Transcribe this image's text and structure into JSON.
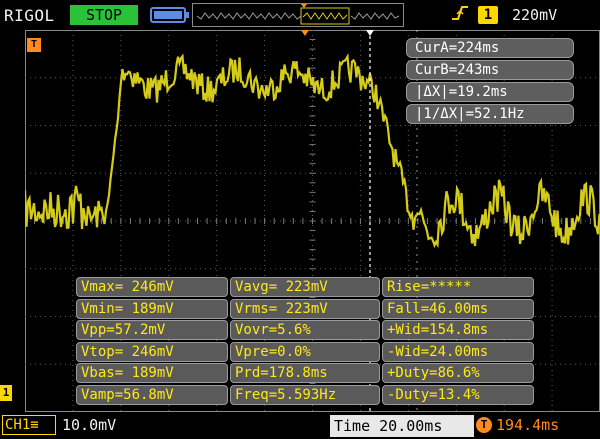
{
  "top_bar": {
    "brand": "RIGOL",
    "run_state": "STOP",
    "trigger_source": "1",
    "trigger_level": "220mV",
    "trigger_edge_icon": "rising-edge-icon"
  },
  "markers": {
    "channel_level": "T",
    "ch1_ground": "1"
  },
  "cursors": {
    "cur_a": "CurA=224ms",
    "cur_b": "CurB=243ms",
    "delta_x": "|ΔX|=19.2ms",
    "inv_delta_x": "|1/ΔX|=52.1Hz"
  },
  "measurements": [
    [
      "Vmax= 246mV",
      "Vavg= 223mV",
      "Rise=*****"
    ],
    [
      "Vmin= 189mV",
      "Vrms= 223mV",
      "Fall=46.00ms"
    ],
    [
      "Vpp=57.2mV",
      "Vovr=5.6%",
      "+Wid=154.8ms"
    ],
    [
      "Vtop= 246mV",
      "Vpre=0.0%",
      "-Wid=24.00ms"
    ],
    [
      "Vbas= 189mV",
      "Prd=178.8ms",
      "+Duty=86.6%"
    ],
    [
      "Vamp=56.8mV",
      "Freq=5.593Hz",
      "-Duty=13.4%"
    ]
  ],
  "bottom_bar": {
    "ch1_label": "CH1",
    "ch1_scale": "10.0mV",
    "timebase": "Time 20.00ms",
    "offset_icon": "T",
    "trigger_offset": "194.4ms"
  },
  "colors": {
    "trace": "#d4cc18",
    "grid": "#5a5a5a",
    "accent_orange": "#ff8a1e",
    "stop_green": "#29c239",
    "channel_yellow": "#ffd700"
  }
}
